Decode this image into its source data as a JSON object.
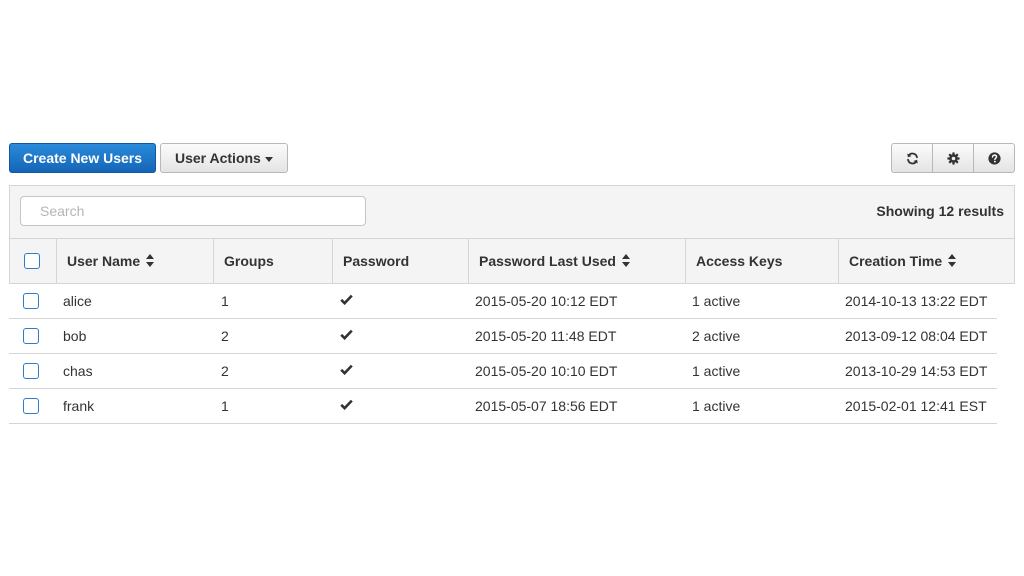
{
  "toolbar": {
    "create_label": "Create New Users",
    "actions_label": "User Actions",
    "icons": [
      "refresh-icon",
      "gear-icon",
      "help-icon"
    ]
  },
  "search": {
    "placeholder": "Search",
    "value": "",
    "results_text": "Showing 12 results"
  },
  "colors": {
    "primary": "#1f75c9",
    "border": "#d5d5d5",
    "checkbox": "#2f7bc8"
  },
  "table": {
    "columns": [
      {
        "label": "User Name",
        "sortable": true
      },
      {
        "label": "Groups",
        "sortable": false
      },
      {
        "label": "Password",
        "sortable": false
      },
      {
        "label": "Password Last Used",
        "sortable": true
      },
      {
        "label": "Access Keys",
        "sortable": false
      },
      {
        "label": "Creation Time",
        "sortable": true
      }
    ],
    "rows": [
      {
        "user": "alice",
        "groups": "1",
        "password": true,
        "last_used": "2015-05-20 10:12 EDT",
        "access_keys": "1 active",
        "created": "2014-10-13 13:22 EDT"
      },
      {
        "user": "bob",
        "groups": "2",
        "password": true,
        "last_used": "2015-05-20 11:48 EDT",
        "access_keys": "2 active",
        "created": "2013-09-12 08:04 EDT"
      },
      {
        "user": "chas",
        "groups": "2",
        "password": true,
        "last_used": "2015-05-20 10:10 EDT",
        "access_keys": "1 active",
        "created": "2013-10-29 14:53 EDT"
      },
      {
        "user": "frank",
        "groups": "1",
        "password": true,
        "last_used": "2015-05-07 18:56 EDT",
        "access_keys": "1 active",
        "created": "2015-02-01 12:41 EST"
      }
    ]
  }
}
